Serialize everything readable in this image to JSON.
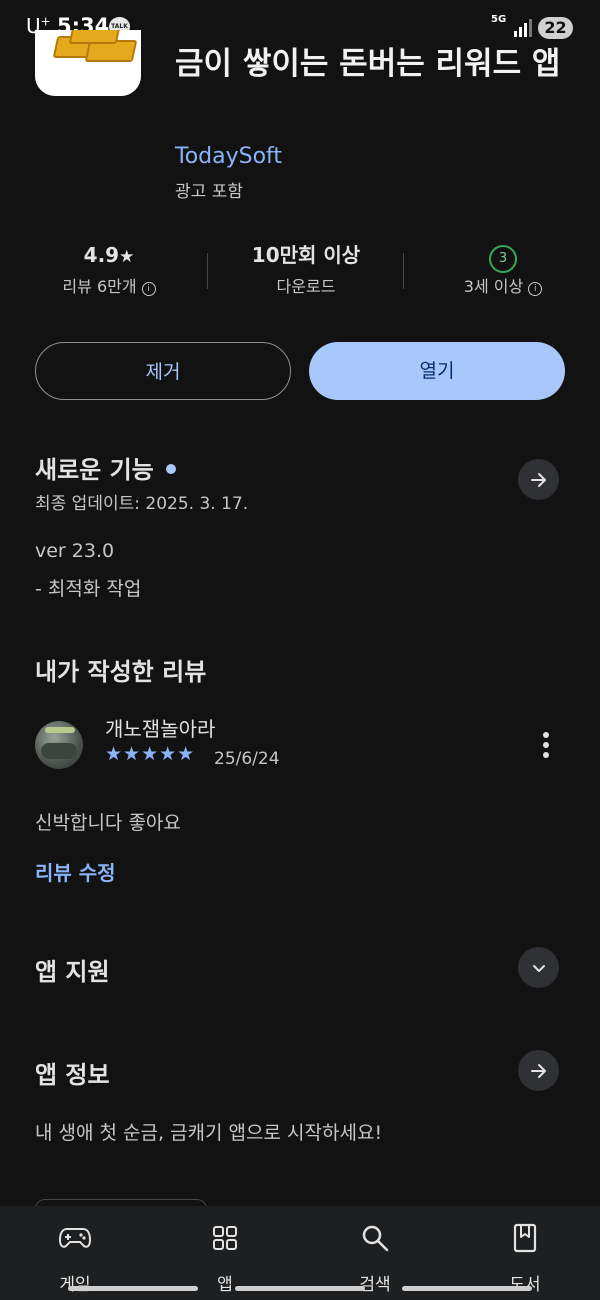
{
  "status_bar": {
    "carrier": "U",
    "carrier_sup": "+",
    "time": "5:34",
    "talk_badge": "TALK",
    "network": "5G",
    "battery": "22"
  },
  "app": {
    "title": "금이 쌓이는 돈버는 리워드 앱",
    "developer": "TodaySoft",
    "ads_label": "광고 포함",
    "icon": "gold-bars-icon"
  },
  "stats": {
    "rating": "4.9",
    "rating_star": "★",
    "reviews": "리뷰 6만개",
    "downloads": "10만회 이상",
    "downloads_label": "다운로드",
    "age_badge": "3",
    "age_label": "3세 이상"
  },
  "actions": {
    "remove": "제거",
    "open": "열기"
  },
  "whats_new": {
    "title": "새로운 기능",
    "updated": "최종 업데이트: 2025. 3. 17.",
    "version": "ver 23.0",
    "note": "- 최적화 작업"
  },
  "my_review": {
    "title": "내가 작성한 리뷰",
    "reviewer": "개노잼놀아라",
    "stars": "★★★★★",
    "rating": 5,
    "date": "25/6/24",
    "text": "신박합니다 좋아요",
    "edit": "리뷰 수정"
  },
  "app_support": {
    "title": "앱 지원"
  },
  "app_info": {
    "title": "앱 정보",
    "description": "내 생애 첫 순금, 금캐기 앱으로 시작하세요!"
  },
  "nav": [
    {
      "label": "게임",
      "icon": "gamepad-icon"
    },
    {
      "label": "앱",
      "icon": "apps-grid-icon"
    },
    {
      "label": "검색",
      "icon": "search-icon"
    },
    {
      "label": "도서",
      "icon": "bookmark-book-icon"
    }
  ],
  "colors": {
    "background": "#121212",
    "accent": "#a8c7fa",
    "link": "#8ab4f8",
    "age_green": "#34a853"
  }
}
